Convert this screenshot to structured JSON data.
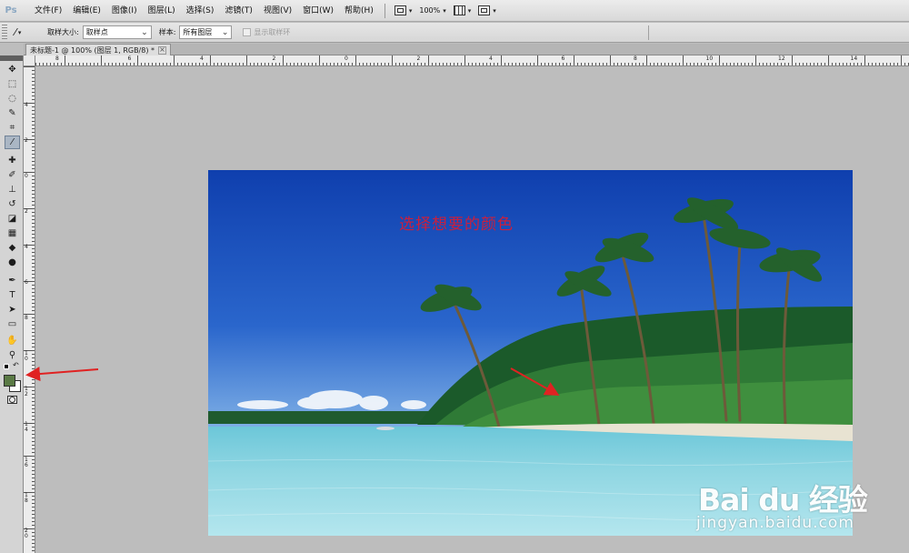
{
  "app": {
    "logo": "Ps"
  },
  "menu": [
    "文件(F)",
    "编辑(E)",
    "图像(I)",
    "图层(L)",
    "选择(S)",
    "滤镜(T)",
    "视图(V)",
    "窗口(W)",
    "帮助(H)"
  ],
  "menu_tools": {
    "zoom": "100%"
  },
  "options": {
    "sample_size_label": "取样大小:",
    "sample_size_value": "取样点",
    "sample_label": "样本:",
    "sample_value": "所有图层",
    "show_ring_label": "显示取样环"
  },
  "document": {
    "tab_title": "未标题-1 @ 100% (图层 1, RGB/8) *",
    "close": "×"
  },
  "ruler": {
    "h_labels": [
      "8",
      "6",
      "4",
      "2",
      "0",
      "2",
      "4",
      "6",
      "8",
      "10",
      "12",
      "14",
      "16",
      "18",
      "20",
      "22",
      "24"
    ],
    "v_labels": [
      "4",
      "2",
      "0",
      "2",
      "4",
      "6",
      "8",
      "10",
      "12",
      "14",
      "16",
      "18",
      "20",
      "22"
    ]
  },
  "toolbox": {
    "tools": [
      {
        "name": "move-tool-icon",
        "glyph": "✥"
      },
      {
        "name": "marquee-tool-icon",
        "glyph": "⬚"
      },
      {
        "name": "lasso-tool-icon",
        "glyph": "◌"
      },
      {
        "name": "quick-select-tool-icon",
        "glyph": "✎"
      },
      {
        "name": "crop-tool-icon",
        "glyph": "⌗"
      },
      {
        "name": "eyedropper-tool-icon",
        "glyph": "⁄"
      },
      {
        "name": "healing-brush-tool-icon",
        "glyph": "✚"
      },
      {
        "name": "brush-tool-icon",
        "glyph": "✐"
      },
      {
        "name": "clone-stamp-tool-icon",
        "glyph": "⊥"
      },
      {
        "name": "history-brush-tool-icon",
        "glyph": "↺"
      },
      {
        "name": "eraser-tool-icon",
        "glyph": "◪"
      },
      {
        "name": "gradient-tool-icon",
        "glyph": "▦"
      },
      {
        "name": "blur-tool-icon",
        "glyph": "◆"
      },
      {
        "name": "dodge-tool-icon",
        "glyph": "●"
      },
      {
        "name": "pen-tool-icon",
        "glyph": "✒"
      },
      {
        "name": "type-tool-icon",
        "glyph": "T"
      },
      {
        "name": "path-select-tool-icon",
        "glyph": "➤"
      },
      {
        "name": "shape-tool-icon",
        "glyph": "▭"
      },
      {
        "name": "hand-tool-icon",
        "glyph": "✋"
      },
      {
        "name": "zoom-tool-icon",
        "glyph": "⚲"
      }
    ],
    "foreground_color": "#5a7a45",
    "background_color": "#ffffff"
  },
  "canvas": {
    "annotation_text": "选择想要的颜色"
  },
  "watermark": {
    "logo": "Bai du 经验",
    "url": "jingyan.baidu.com"
  },
  "colors": {
    "annotation": "#e02222",
    "sky": "#1747b8",
    "sea": "#8fd3e0"
  }
}
